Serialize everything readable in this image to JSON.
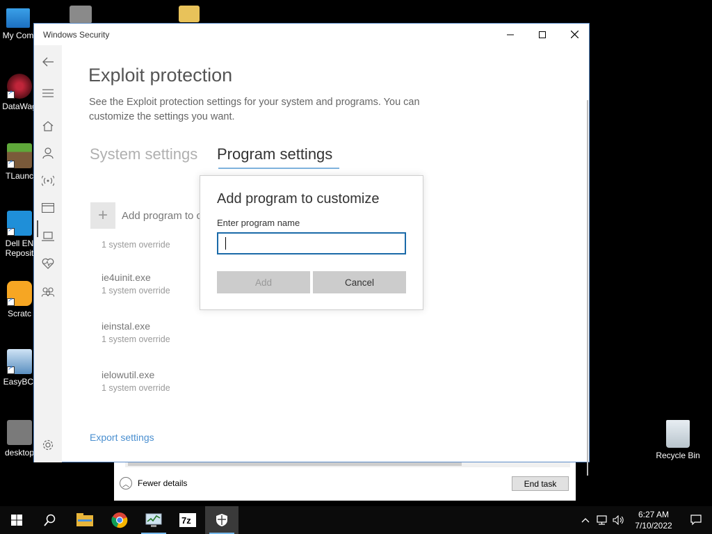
{
  "desktop": {
    "icons": [
      {
        "label": "My Com",
        "icon": "computer-icon"
      },
      {
        "label": "DataWag",
        "icon": "datawag-icon"
      },
      {
        "label": "TLaunc",
        "icon": "minecraft-icon"
      },
      {
        "label": "Dell EN",
        "label2": "Reposit",
        "icon": "folder-icon"
      },
      {
        "label": "Scratc",
        "icon": "scratch-icon"
      },
      {
        "label": "EasyBCI",
        "icon": "easybcd-icon"
      },
      {
        "label": "desktop",
        "icon": "gear-file-icon"
      }
    ],
    "recycle_bin": "Recycle Bin"
  },
  "window": {
    "title": "Windows Security",
    "page_title": "Exploit protection",
    "description": "See the Exploit protection settings for your system and programs.  You can customize the settings you want.",
    "tabs": [
      {
        "label": "System settings",
        "active": false
      },
      {
        "label": "Program settings",
        "active": true
      }
    ],
    "add_program_label": "Add program to customize",
    "programs": [
      {
        "name": "",
        "detail": "1 system override"
      },
      {
        "name": "ie4uinit.exe",
        "detail": "1 system override"
      },
      {
        "name": "ieinstal.exe",
        "detail": "1 system override"
      },
      {
        "name": "ielowutil.exe",
        "detail": "1 system override"
      }
    ],
    "export_label": "Export settings",
    "nav_icons": [
      "back-arrow-icon",
      "hamburger-icon",
      "home-icon",
      "person-icon",
      "wireless-icon",
      "app-browser-icon",
      "laptop-icon",
      "heart-icon",
      "family-icon",
      "settings-icon"
    ]
  },
  "dialog": {
    "title": "Add program to customize",
    "field_label": "Enter program name",
    "field_value": "",
    "add_label": "Add",
    "cancel_label": "Cancel"
  },
  "task_manager": {
    "fewer_details": "Fewer details",
    "end_task": "End task"
  },
  "taskbar": {
    "time": "6:27 AM",
    "date": "7/10/2022",
    "apps": [
      "start-icon",
      "search-icon",
      "file-explorer-icon",
      "chrome-icon",
      "task-manager-icon",
      "7zip-icon",
      "windows-security-icon"
    ]
  },
  "colors": {
    "accent": "#1a6aa8",
    "link": "#4a8fd0"
  }
}
